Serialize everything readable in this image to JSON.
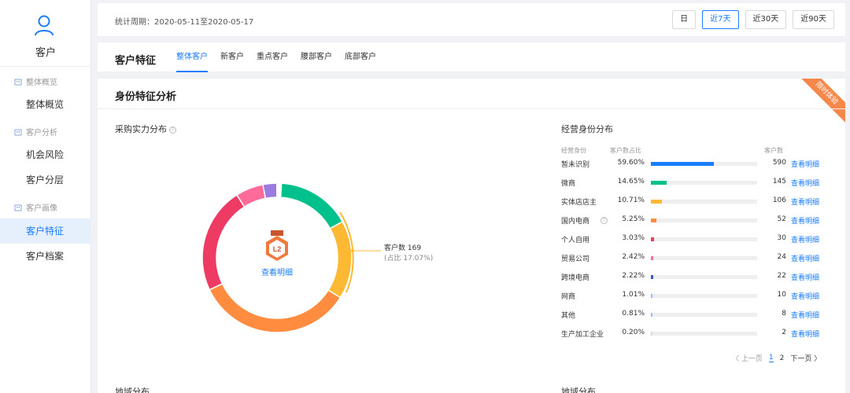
{
  "sidebar": {
    "title": "客户",
    "groups": [
      {
        "label": "整体概览"
      },
      {
        "label": "客户分析"
      },
      {
        "label": "客户画像"
      }
    ],
    "items": [
      {
        "label": "整体概览"
      },
      {
        "label": "机会风险"
      },
      {
        "label": "客户分层"
      },
      {
        "label": "客户特征"
      },
      {
        "label": "客户档案"
      }
    ],
    "active_item": "客户特征"
  },
  "header": {
    "period": "统计周期：2020-05-11至2020-05-17",
    "range_buttons": [
      "日",
      "近7天",
      "近30天",
      "近90天"
    ],
    "active_range": "近7天"
  },
  "tabbar": {
    "title": "客户特征",
    "tabs": [
      "整体客户",
      "新客户",
      "重点客户",
      "腰部客户",
      "底部客户"
    ],
    "active_tab": "整体客户"
  },
  "panel": {
    "title": "身份特征分析",
    "ribbon": "限时体验",
    "left_section": "采购实力分布",
    "right_section": "经营身份分布",
    "bottom_left": "地域分布",
    "bottom_right": "地域分布"
  },
  "donut": {
    "center_link": "查看明细",
    "callout_main": "客户数 169",
    "callout_sub": "(占比 17.07%)",
    "medal_label": "L2",
    "segments": [
      {
        "color": "#00c08b",
        "share": 0.16
      },
      {
        "color": "#fdb933",
        "share": 0.17
      },
      {
        "color": "#ff8c3f",
        "share": 0.34
      },
      {
        "color": "#ee3b64",
        "share": 0.23
      },
      {
        "color": "#ff6b9a",
        "share": 0.06
      },
      {
        "color": "#9b7be0",
        "share": 0.03
      }
    ]
  },
  "table": {
    "headers": {
      "identity": "经营身份",
      "share": "客户数占比",
      "count": "客户数"
    },
    "rows": [
      {
        "name": "暂未识别",
        "pct": "59.60%",
        "share": 0.596,
        "color": "#1a7cff",
        "count": "590",
        "link": "查看明细"
      },
      {
        "name": "微商",
        "pct": "14.65%",
        "share": 0.1465,
        "color": "#00c08b",
        "count": "145",
        "link": "查看明细"
      },
      {
        "name": "实体店店主",
        "pct": "10.71%",
        "share": 0.1071,
        "color": "#fdb933",
        "count": "106",
        "link": "查看明细"
      },
      {
        "name": "国内电商",
        "pct": "5.25%",
        "share": 0.0525,
        "color": "#ff8c3f",
        "count": "52",
        "link": "查看明细",
        "help": true
      },
      {
        "name": "个人自用",
        "pct": "3.03%",
        "share": 0.0303,
        "color": "#ee3b64",
        "count": "30",
        "link": "查看明细"
      },
      {
        "name": "贸易公司",
        "pct": "2.42%",
        "share": 0.0242,
        "color": "#ff6b9a",
        "count": "24",
        "link": "查看明细"
      },
      {
        "name": "跨境电商",
        "pct": "2.22%",
        "share": 0.0222,
        "color": "#3358d4",
        "count": "22",
        "link": "查看明细"
      },
      {
        "name": "网商",
        "pct": "1.01%",
        "share": 0.0101,
        "color": "#9bb6f5",
        "count": "10",
        "link": "查看明细"
      },
      {
        "name": "其他",
        "pct": "0.81%",
        "share": 0.0081,
        "color": "#9bb6f5",
        "count": "8",
        "link": "查看明细"
      },
      {
        "name": "生产加工企业",
        "pct": "0.20%",
        "share": 0.002,
        "color": "#cfd8e8",
        "count": "2",
        "link": "查看明细"
      }
    ]
  },
  "pager": {
    "prev": "〈 上一页",
    "pages": [
      "1",
      "2"
    ],
    "current": "1",
    "next": "下一页 〉"
  }
}
